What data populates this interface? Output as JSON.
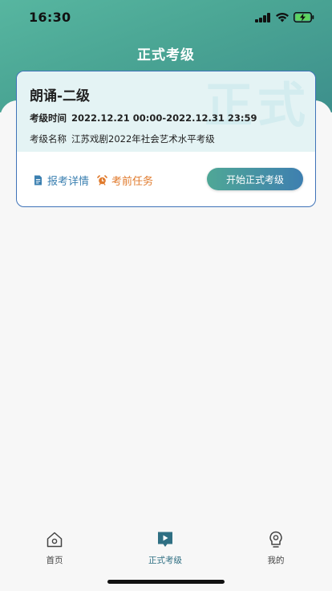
{
  "status_bar": {
    "time": "16:30"
  },
  "header": {
    "title": "正式考级"
  },
  "card": {
    "watermark": "正式",
    "title": "朗诵-二级",
    "exam_time_label": "考级时间",
    "exam_time_value": "2022.12.21 00:00-2022.12.31 23:59",
    "exam_name_label": "考级名称",
    "exam_name_value": "江苏戏剧2022年社会艺术水平考级",
    "detail_label": "报考详情",
    "task_label": "考前任务",
    "start_button_label": "开始正式考级"
  },
  "tabbar": {
    "items": [
      {
        "label": "首页",
        "icon": "home-icon",
        "active": false
      },
      {
        "label": "正式考级",
        "icon": "play-icon",
        "active": true
      },
      {
        "label": "我的",
        "icon": "profile-icon",
        "active": false
      }
    ]
  },
  "colors": {
    "header_gradient_start": "#57b6a0",
    "header_gradient_end": "#3d8f8c",
    "card_border": "#3f73b8",
    "detail_blue": "#3a7fb0",
    "task_orange": "#e07a2c",
    "active_tab": "#2f6f83"
  }
}
